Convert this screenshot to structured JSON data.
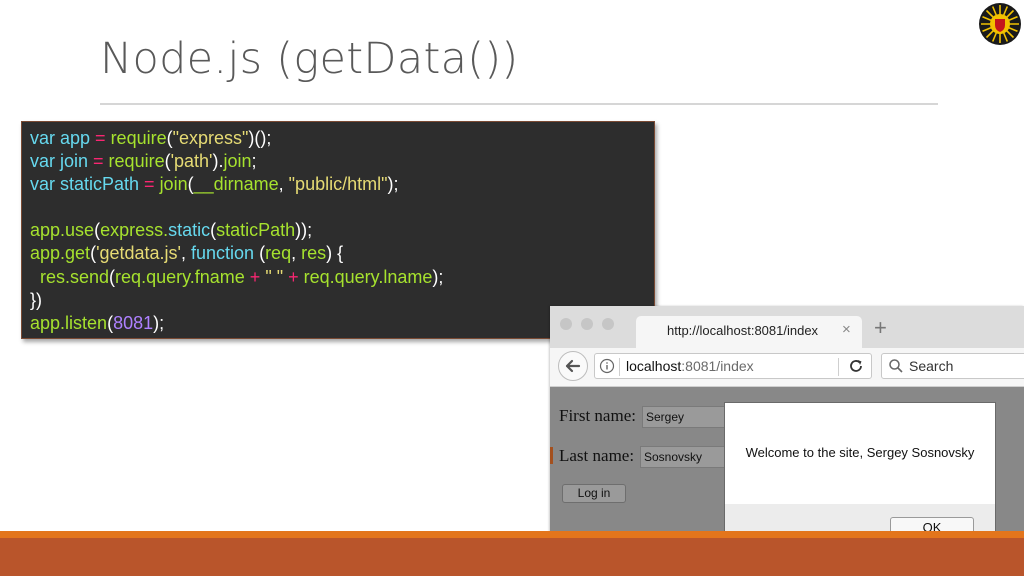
{
  "slide": {
    "title": "Node.js (getData())"
  },
  "code": {
    "lines": [
      [
        {
          "t": "var app ",
          "c": "kw"
        },
        {
          "t": "= ",
          "c": "op"
        },
        {
          "t": "require",
          "c": "fn"
        },
        {
          "t": "(",
          "c": "pl"
        },
        {
          "t": "\"express\"",
          "c": "str"
        },
        {
          "t": ")();",
          "c": "pl"
        }
      ],
      [
        {
          "t": "var join ",
          "c": "kw"
        },
        {
          "t": "= ",
          "c": "op"
        },
        {
          "t": "require",
          "c": "fn"
        },
        {
          "t": "(",
          "c": "pl"
        },
        {
          "t": "'path'",
          "c": "str"
        },
        {
          "t": ").",
          "c": "pl"
        },
        {
          "t": "join",
          "c": "fn"
        },
        {
          "t": ";",
          "c": "pl"
        }
      ],
      [
        {
          "t": "var staticPath ",
          "c": "kw"
        },
        {
          "t": "= ",
          "c": "op"
        },
        {
          "t": "join",
          "c": "fn"
        },
        {
          "t": "(",
          "c": "pl"
        },
        {
          "t": "__dirname",
          "c": "fn"
        },
        {
          "t": ", ",
          "c": "pl"
        },
        {
          "t": "\"public/html\"",
          "c": "str"
        },
        {
          "t": ");",
          "c": "pl"
        }
      ],
      [],
      [
        {
          "t": "app.use",
          "c": "fn"
        },
        {
          "t": "(",
          "c": "pl"
        },
        {
          "t": "express.",
          "c": "fn"
        },
        {
          "t": "static",
          "c": "kw"
        },
        {
          "t": "(",
          "c": "pl"
        },
        {
          "t": "staticPath",
          "c": "fn"
        },
        {
          "t": "));",
          "c": "pl"
        }
      ],
      [
        {
          "t": "app.get",
          "c": "fn"
        },
        {
          "t": "(",
          "c": "pl"
        },
        {
          "t": "'getdata.js'",
          "c": "str"
        },
        {
          "t": ", ",
          "c": "pl"
        },
        {
          "t": "function ",
          "c": "kw"
        },
        {
          "t": "(",
          "c": "pl"
        },
        {
          "t": "req",
          "c": "fn"
        },
        {
          "t": ", ",
          "c": "pl"
        },
        {
          "t": "res",
          "c": "fn"
        },
        {
          "t": ") {",
          "c": "pl"
        }
      ],
      [
        {
          "t": "  res.send",
          "c": "fn"
        },
        {
          "t": "(",
          "c": "pl"
        },
        {
          "t": "req.query.fname ",
          "c": "fn"
        },
        {
          "t": "+ ",
          "c": "op"
        },
        {
          "t": "\" \" ",
          "c": "str"
        },
        {
          "t": "+ ",
          "c": "op"
        },
        {
          "t": "req.query.lname",
          "c": "fn"
        },
        {
          "t": ");",
          "c": "pl"
        }
      ],
      [
        {
          "t": "})",
          "c": "pl"
        }
      ],
      [
        {
          "t": "app.listen",
          "c": "fn"
        },
        {
          "t": "(",
          "c": "pl"
        },
        {
          "t": "8081",
          "c": "num"
        },
        {
          "t": ");",
          "c": "pl"
        }
      ]
    ]
  },
  "browser": {
    "tab_title": "http://localhost:8081/index",
    "tab_close": "×",
    "new_tab": "+",
    "url_host": "localhost",
    "url_rest": ":8081/index",
    "search_placeholder": "Search",
    "form": {
      "first_label": "First name:",
      "first_value": "Sergey",
      "last_label": "Last name:",
      "last_value": "Sosnovsky",
      "login_label": "Log in"
    },
    "dialog": {
      "message": "Welcome to the site, Sergey Sosnovsky",
      "ok_label": "OK"
    }
  },
  "colors": {
    "code_bg": "#2d2d2d",
    "keyword": "#66d9ef",
    "function": "#a6e22e",
    "string": "#e6db74",
    "operator": "#f92672",
    "number": "#ae81ff",
    "accent_band": "#b9552b",
    "accent_band_light": "#e3751c"
  },
  "icons": {
    "logo": "university-seal-icon",
    "back": "back-arrow-icon",
    "info": "info-icon",
    "reload": "reload-icon",
    "search": "search-icon",
    "close_tab": "close-icon",
    "new_tab": "plus-icon"
  }
}
